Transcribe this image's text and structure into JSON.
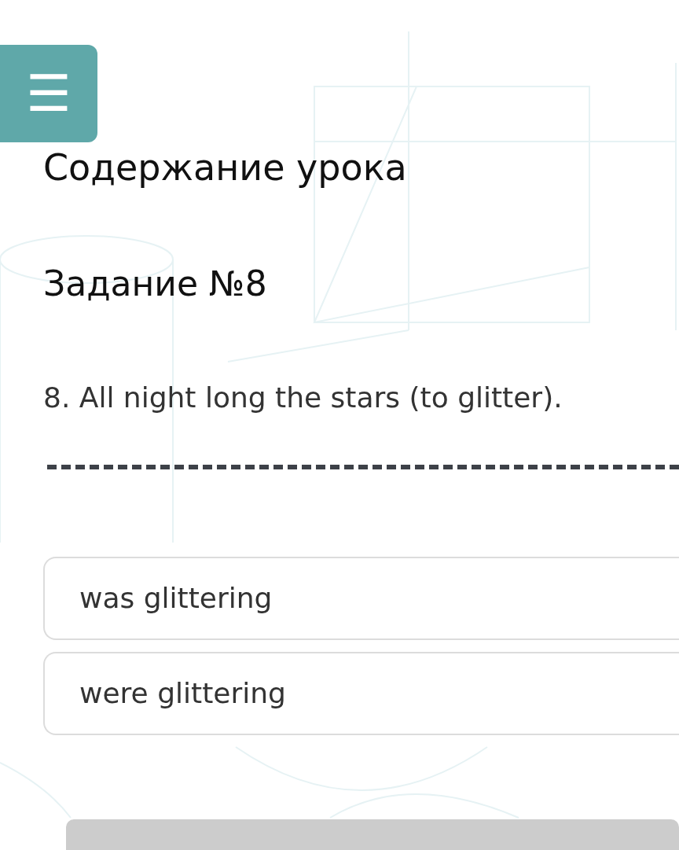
{
  "menu_button": {
    "icon": "☰"
  },
  "lesson_title": "Содержание урока",
  "task_title": "Задание №8",
  "question": "8. All night long the stars (to glitter).",
  "answer_blank": {
    "filled": false
  },
  "options": [
    {
      "label": "was glittering",
      "selected": false
    },
    {
      "label": "were glittering",
      "selected": false
    }
  ],
  "submit_button": {
    "disabled": true
  }
}
